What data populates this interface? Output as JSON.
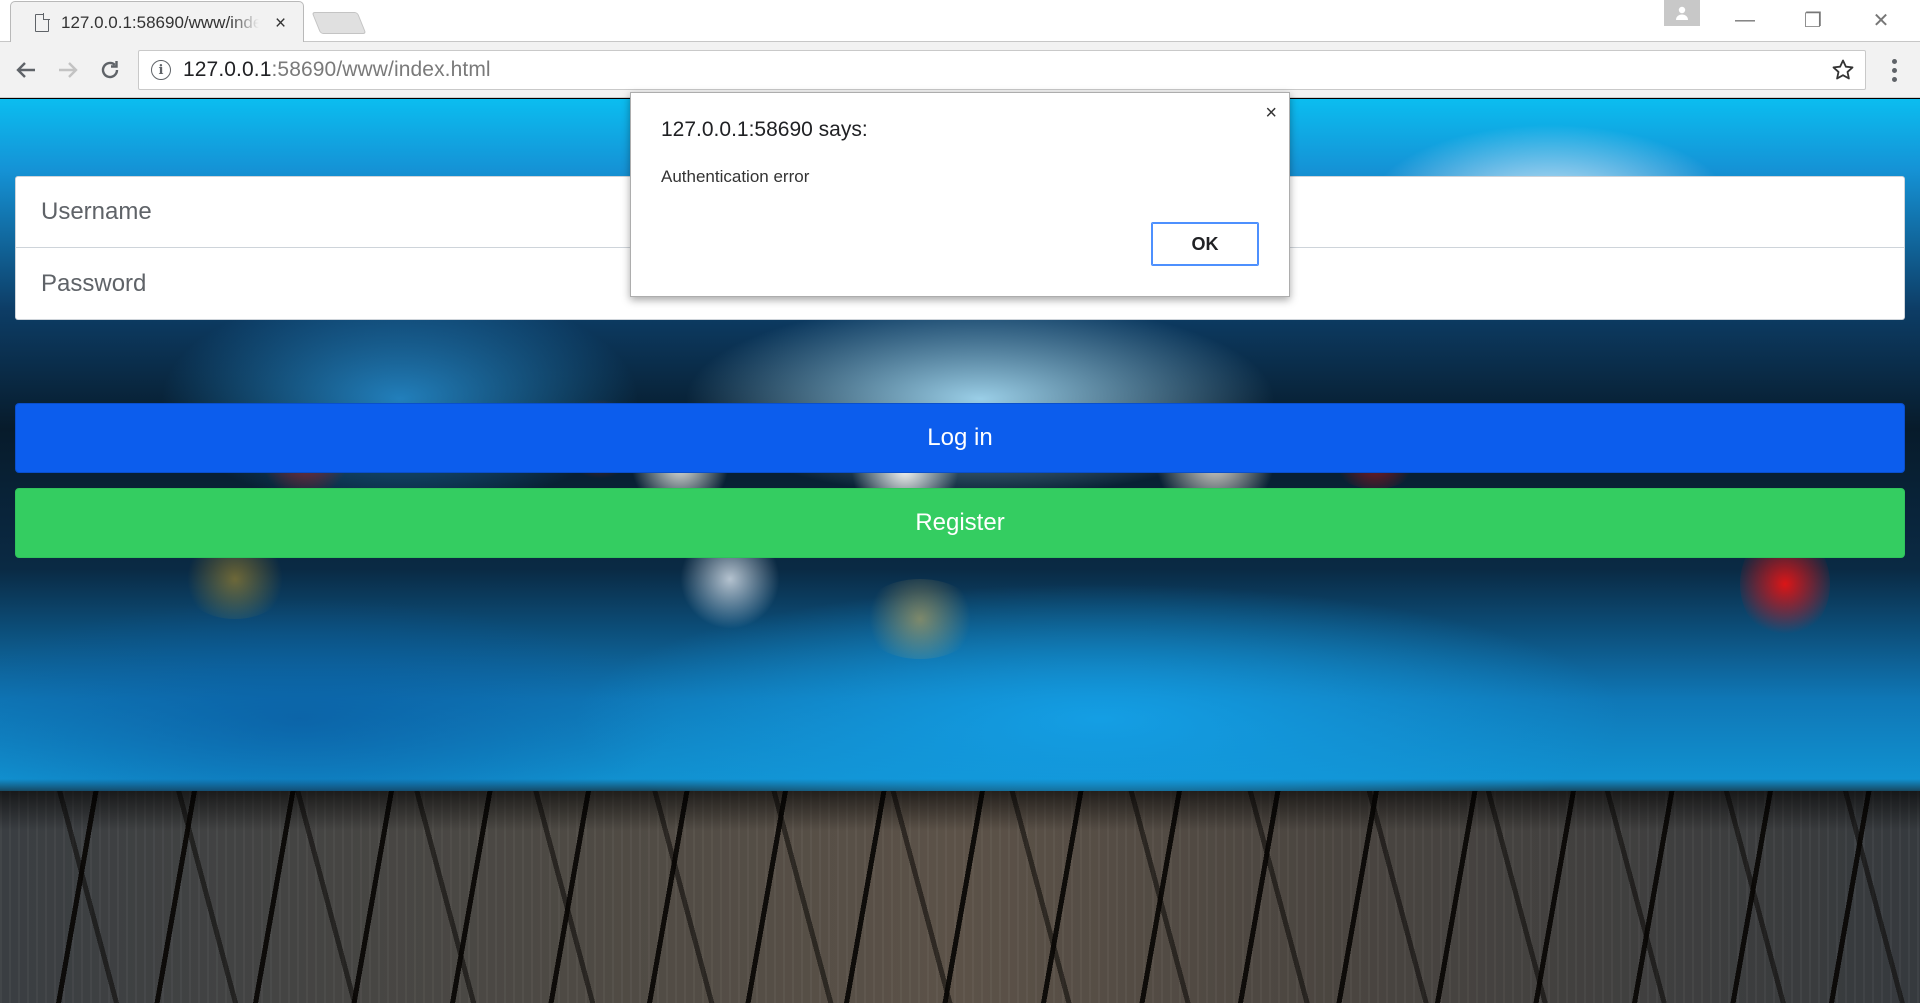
{
  "browser": {
    "tab": {
      "title": "127.0.0.1:58690/www/index.html",
      "close_glyph": "×"
    },
    "window_controls": {
      "minimize_glyph": "—",
      "maximize_glyph": "❐",
      "close_glyph": "✕"
    },
    "address_bar": {
      "host": "127.0.0.1",
      "rest": ":58690/www/index.html",
      "info_glyph": "i"
    },
    "icons": {
      "back": "arrow-left-icon",
      "forward": "arrow-right-icon",
      "reload": "reload-icon",
      "star": "star-icon",
      "menu": "kebab-menu-icon",
      "profile": "person-icon",
      "page": "file-icon"
    }
  },
  "form": {
    "username_placeholder": "Username",
    "password_placeholder": "Password",
    "login_label": "Log in",
    "register_label": "Register"
  },
  "dialog": {
    "title": "127.0.0.1:58690 says:",
    "message": "Authentication error",
    "ok_label": "OK",
    "close_glyph": "×"
  },
  "colors": {
    "login_button": "#0c5ded",
    "register_button": "#34cd61",
    "ok_focus_ring": "#4d90fe"
  }
}
